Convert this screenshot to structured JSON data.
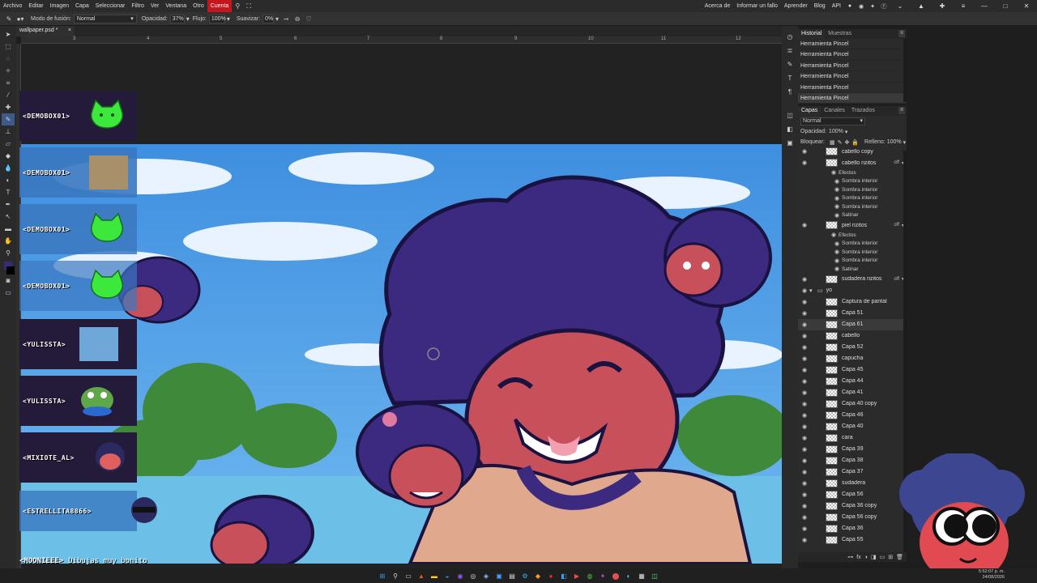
{
  "menu": {
    "items": [
      "Archivo",
      "Editar",
      "Imagen",
      "Capa",
      "Seleccionar",
      "Filtro",
      "Ver",
      "Ventana",
      "Otro"
    ],
    "account": "Cuenta",
    "right_links": [
      "Acerca de",
      "Informar un fallo",
      "Aprender",
      "Blog",
      "API"
    ],
    "accent": "#c4161c"
  },
  "options": {
    "blend_label": "Modo de fusión:",
    "blend_value": "Normal",
    "opacity_label": "Opacidad:",
    "opacity_value": "37%",
    "flow_label": "Flujo:",
    "flow_value": "100%",
    "smooth_label": "Suavizar:",
    "smooth_value": "0%"
  },
  "document": {
    "tab_title": "wallpaper.psd *",
    "close": "×"
  },
  "ruler": {
    "ticks": [
      "3",
      "4",
      "5",
      "6",
      "7",
      "8",
      "9",
      "10",
      "11",
      "12"
    ]
  },
  "chat": {
    "messages": [
      {
        "user": "<DEMOBOX01>"
      },
      {
        "user": "<DEMOBOX01>"
      },
      {
        "user": "<DEMOBOX01>"
      },
      {
        "user": "<DEMOBOX01>"
      },
      {
        "user": "<YULISSTA>"
      },
      {
        "user": "<YULISSTA>"
      },
      {
        "user": "<MIXIOTE_AL>"
      },
      {
        "user": "<ESTRELLITA8866>"
      }
    ],
    "last": {
      "user": "<MOONIEEE>",
      "text": "Dibujas muy bonito"
    }
  },
  "history": {
    "tabs": [
      "Historial",
      "Muestras"
    ],
    "rows": [
      "Herramienta Pincel",
      "Herramienta Pincel",
      "Herramienta Pincel",
      "Herramienta Pincel",
      "Herramienta Pincel",
      "Herramienta Pincel"
    ]
  },
  "layers": {
    "tabs": [
      "Capas",
      "Canales",
      "Trazados"
    ],
    "blend": "Normal",
    "opacity_label": "Opacidad:",
    "opacity_value": "100%",
    "lock_label": "Bloquear:",
    "fill_label": "Relleno:",
    "fill_value": "100%",
    "effects_label": "Efectos",
    "fx": "off",
    "rows": [
      {
        "name": "cabello copy",
        "type": "layer"
      },
      {
        "name": "cabello rizitos",
        "type": "layer",
        "fx": true
      },
      {
        "name": "Efectos",
        "type": "effects-header"
      },
      {
        "name": "Sombra interior",
        "type": "effect"
      },
      {
        "name": "Sombra interior",
        "type": "effect"
      },
      {
        "name": "Sombra interior",
        "type": "effect"
      },
      {
        "name": "Sombra interior",
        "type": "effect"
      },
      {
        "name": "Satinar",
        "type": "effect"
      },
      {
        "name": "piel rizitos",
        "type": "layer",
        "fx": true
      },
      {
        "name": "Efectos",
        "type": "effects-header"
      },
      {
        "name": "Sombra interior",
        "type": "effect"
      },
      {
        "name": "Sombra interior",
        "type": "effect"
      },
      {
        "name": "Sombra interior",
        "type": "effect"
      },
      {
        "name": "Satinar",
        "type": "effect"
      },
      {
        "name": "sudadera rizitos",
        "type": "layer",
        "fx": true
      },
      {
        "name": "yo",
        "type": "group"
      },
      {
        "name": "Captura de pantal",
        "type": "layer"
      },
      {
        "name": "Capa 51",
        "type": "layer"
      },
      {
        "name": "Capa 61",
        "type": "layer",
        "selected": true
      },
      {
        "name": "cabello",
        "type": "layer"
      },
      {
        "name": "Capa 52",
        "type": "layer"
      },
      {
        "name": "capucha",
        "type": "layer"
      },
      {
        "name": "Capa 45",
        "type": "layer"
      },
      {
        "name": "Capa 44",
        "type": "layer"
      },
      {
        "name": "Capa 41",
        "type": "layer"
      },
      {
        "name": "Capa 40 copy",
        "type": "layer"
      },
      {
        "name": "Capa 46",
        "type": "layer"
      },
      {
        "name": "Capa 40",
        "type": "layer"
      },
      {
        "name": "cara",
        "type": "layer"
      },
      {
        "name": "Capa 39",
        "type": "layer"
      },
      {
        "name": "Capa 38",
        "type": "layer"
      },
      {
        "name": "Capa 37",
        "type": "layer"
      },
      {
        "name": "sudadera",
        "type": "layer"
      },
      {
        "name": "Capa 56",
        "type": "layer"
      },
      {
        "name": "Capa 36 copy",
        "type": "layer"
      },
      {
        "name": "Capa 56 copy",
        "type": "layer"
      },
      {
        "name": "Capa 36",
        "type": "layer"
      },
      {
        "name": "Capa 55",
        "type": "layer"
      }
    ]
  },
  "taskbar": {
    "time": "5:52:07 p. m.",
    "date": "24/08/2026"
  }
}
